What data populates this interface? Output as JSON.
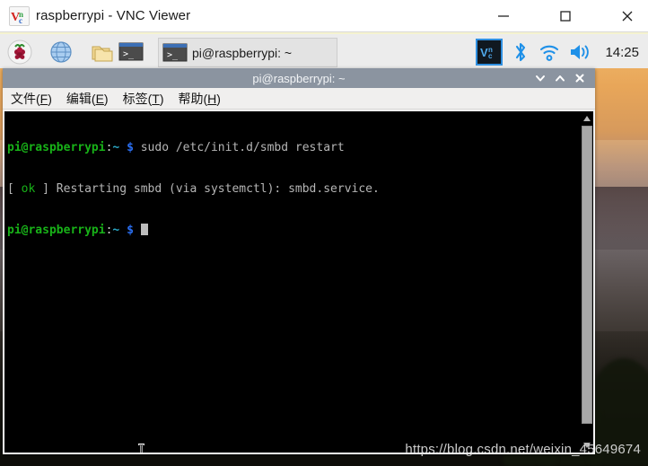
{
  "vnc_window": {
    "title": "raspberrypi - VNC Viewer",
    "logo_name": "vnc-logo",
    "controls": {
      "minimize": "minimize",
      "maximize": "maximize",
      "close": "close"
    }
  },
  "taskbar": {
    "launchers": [
      {
        "name": "raspberry-menu-icon",
        "label": "Menu"
      },
      {
        "name": "web-browser-icon",
        "label": "Web Browser"
      },
      {
        "name": "file-manager-icon",
        "label": "File Manager"
      },
      {
        "name": "terminal-icon",
        "label": "Terminal"
      }
    ],
    "task_button": {
      "label": "pi@raspberrypi: ~",
      "icon": "terminal-icon"
    },
    "tray": {
      "vnc": "vnc-server-icon",
      "bluetooth": "bluetooth-icon",
      "wifi": "wifi-icon",
      "volume": "volume-icon",
      "clock": "14:25"
    }
  },
  "terminal": {
    "title": "pi@raspberrypi: ~",
    "controls": {
      "minimize": "chevron-down-icon",
      "maximize": "chevron-up-icon",
      "close": "close-icon"
    },
    "menu": [
      {
        "name": "menu-file",
        "text": "文件",
        "accel": "F"
      },
      {
        "name": "menu-edit",
        "text": "编辑",
        "accel": "E"
      },
      {
        "name": "menu-tabs",
        "text": "标签",
        "accel": "T"
      },
      {
        "name": "menu-help",
        "text": "帮助",
        "accel": "H"
      }
    ],
    "prompt": {
      "user_host": "pi@raspberrypi",
      "colon": ":",
      "path": "~",
      "sigil": "$"
    },
    "lines": {
      "line1_command": " sudo /etc/init.d/smbd restart",
      "line2_status_open": "[ ",
      "line2_status_ok": "ok",
      "line2_status_close": " ] ",
      "line2_text": "Restarting smbd (via systemctl): smbd.service."
    },
    "scrollbar": {
      "up_arrow": "scroll-up-arrow",
      "thumb": "scroll-thumb",
      "down_arrow": "scroll-down-arrow"
    }
  },
  "watermark": {
    "text": "https://blog.csdn.net/weixin_45649674"
  },
  "colors": {
    "taskbar_bg": "#ececec",
    "terminal_title_bg": "#8b94a0",
    "terminal_bg": "#000000",
    "prompt_green": "#18b218",
    "prompt_blue": "#2a6ef0",
    "accent_blue": "#2f8fe0"
  }
}
